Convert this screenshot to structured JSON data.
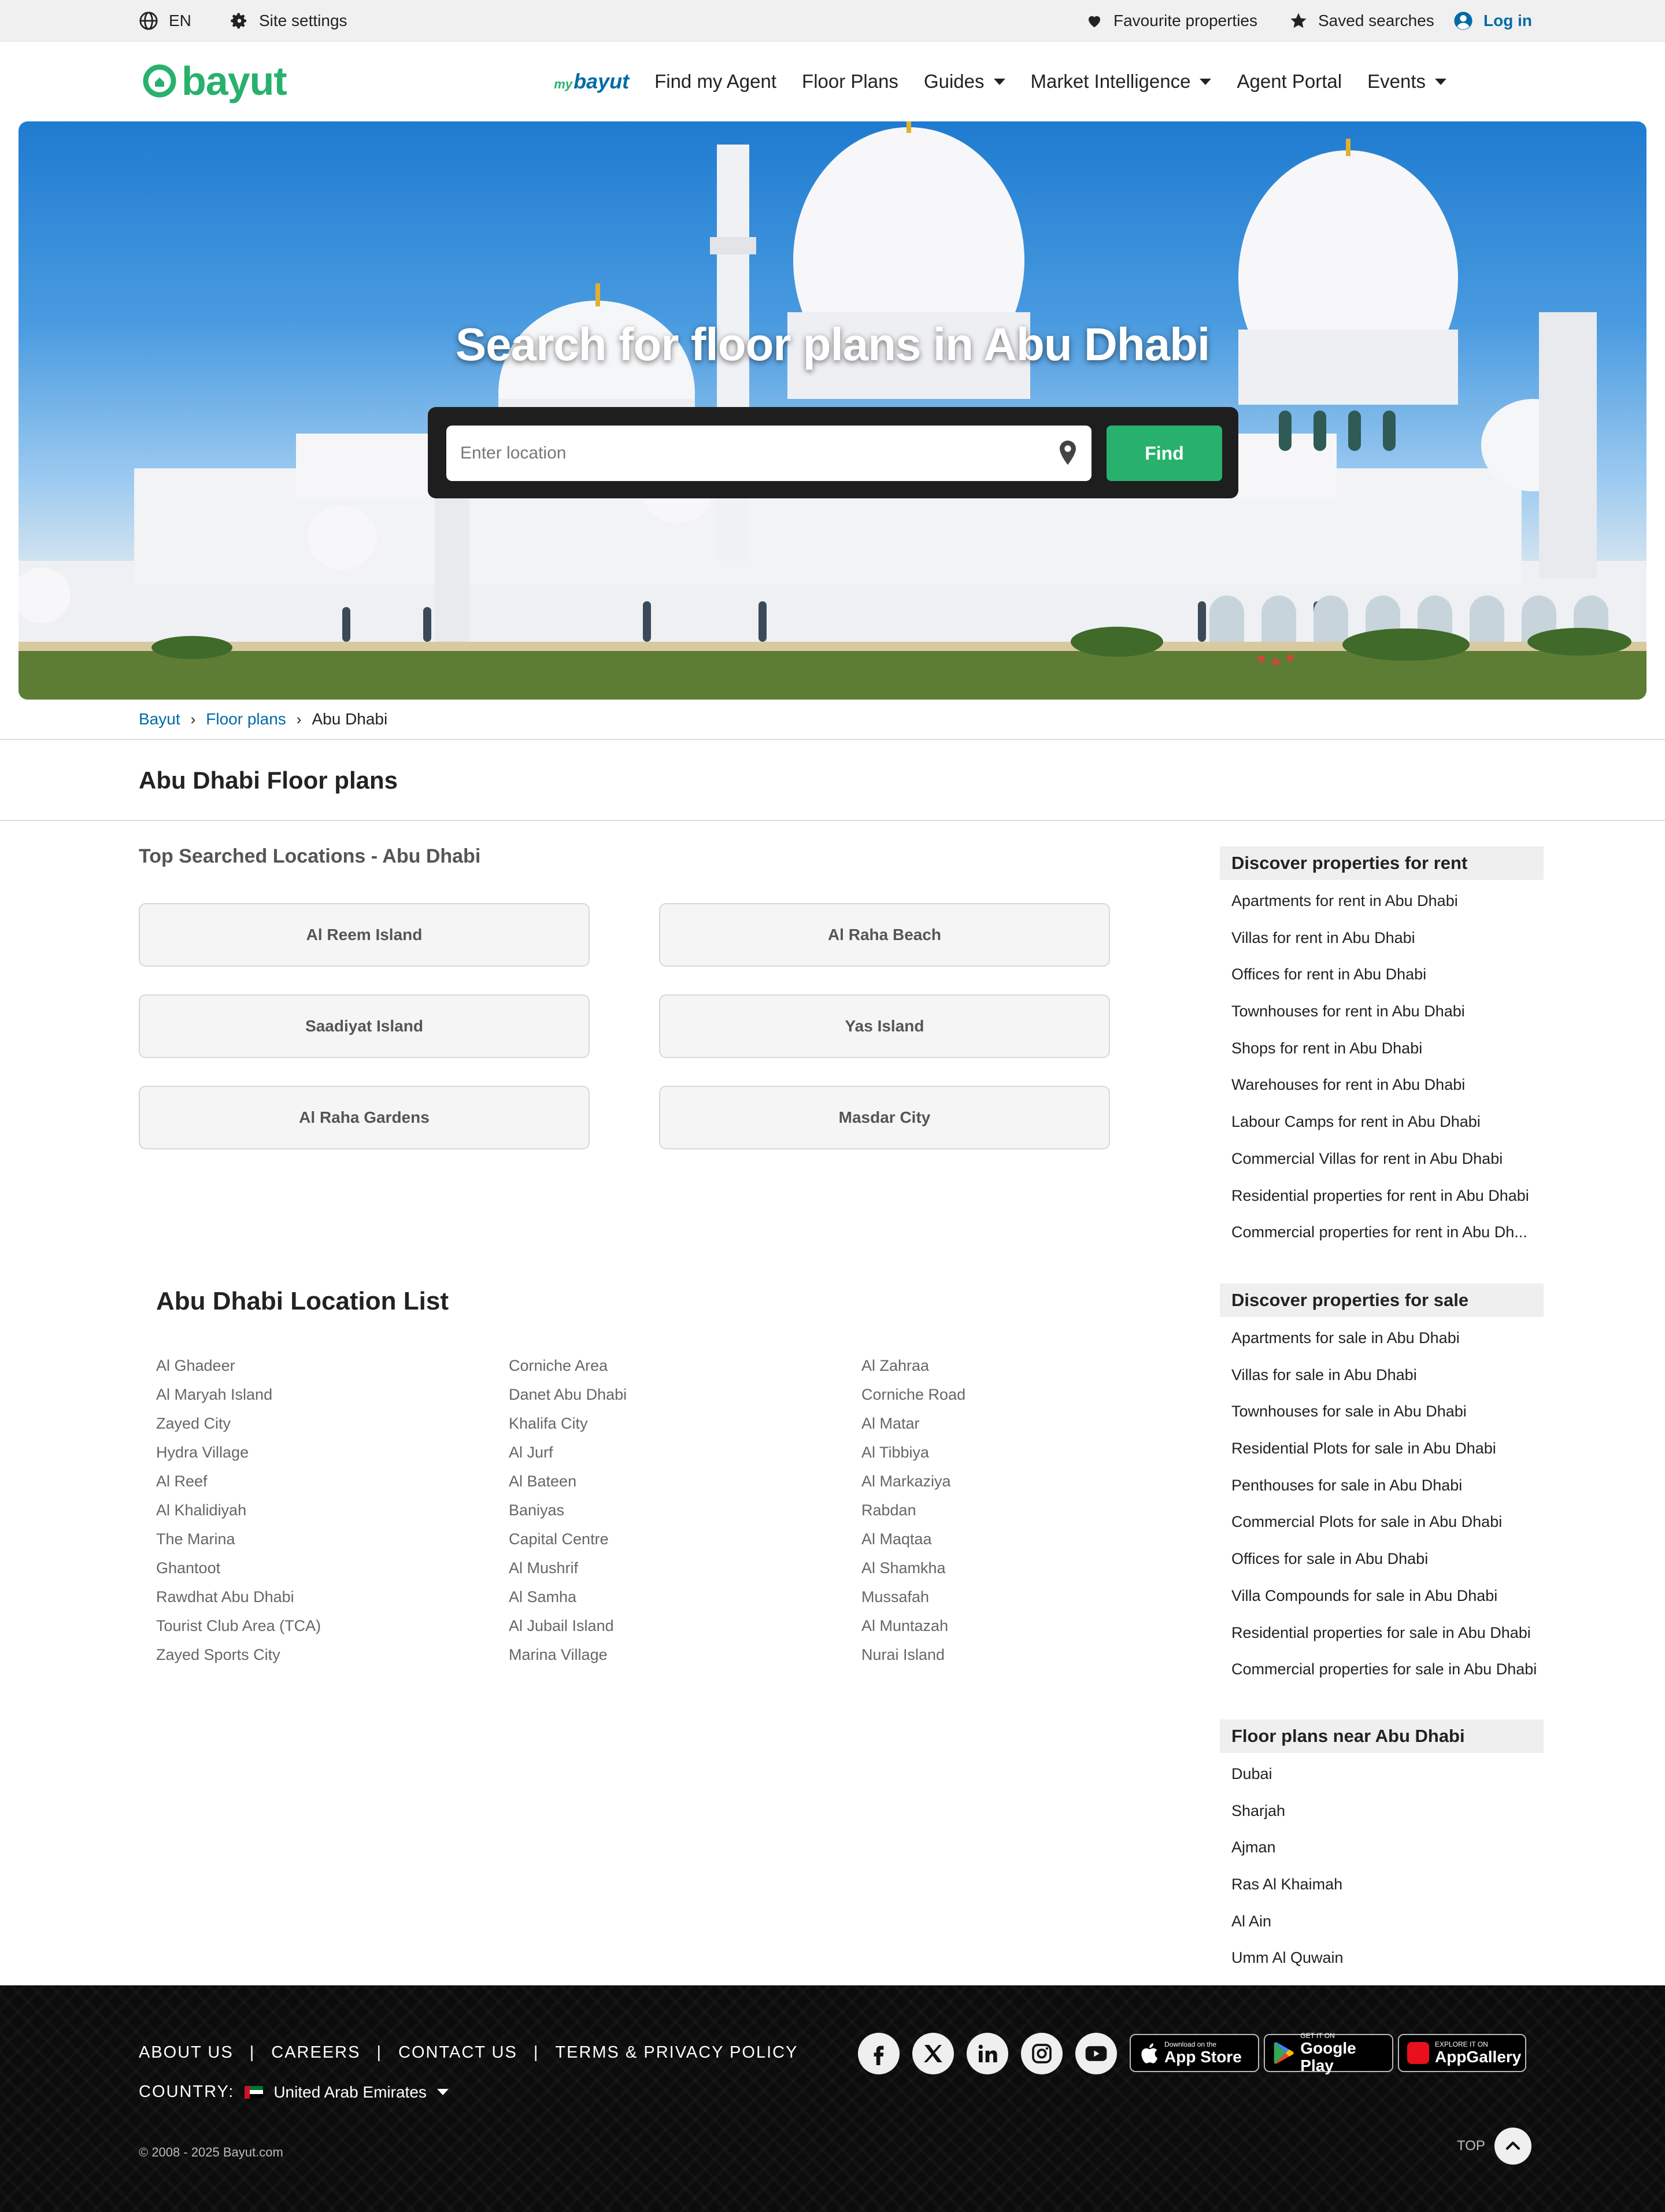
{
  "utility_bar": {
    "language": "EN",
    "site_settings": "Site settings",
    "favourite": "Favourite properties",
    "saved": "Saved searches",
    "login": "Log in"
  },
  "nav": {
    "logo": "bayut",
    "mybayut_prefix": "my",
    "mybayut_name": "bayut",
    "links": [
      "Find my Agent",
      "Floor Plans",
      "Guides",
      "Market Intelligence",
      "Agent Portal",
      "Events"
    ]
  },
  "hero": {
    "title": "Search for floor plans in Abu Dhabi",
    "search_placeholder": "Enter location",
    "find_button": "Find"
  },
  "breadcrumb": [
    "Bayut",
    "Floor plans",
    "Abu Dhabi"
  ],
  "page_title": "Abu Dhabi Floor plans",
  "top_searched": {
    "title": "Top Searched Locations - Abu Dhabi",
    "items": [
      "Al Reem Island",
      "Al Raha Beach",
      "Saadiyat Island",
      "Yas Island",
      "Al Raha Gardens",
      "Masdar City"
    ]
  },
  "location_list": {
    "title": "Abu Dhabi Location List",
    "columns": [
      [
        "Al Ghadeer",
        "Al Maryah Island",
        "Zayed City",
        "Hydra Village",
        "Al Reef",
        "Al Khalidiyah",
        "The Marina",
        "Ghantoot",
        "Rawdhat Abu Dhabi",
        "Tourist Club Area (TCA)",
        "Zayed Sports City"
      ],
      [
        "Corniche Area",
        "Danet Abu Dhabi",
        "Khalifa City",
        "Al Jurf",
        "Al Bateen",
        "Baniyas",
        "Capital Centre",
        "Al Mushrif",
        "Al Samha",
        "Al Jubail Island",
        "Marina Village"
      ],
      [
        "Al Zahraa",
        "Corniche Road",
        "Al Matar",
        "Al Tibbiya",
        "Al Markaziya",
        "Rabdan",
        "Al Maqtaa",
        "Al Shamkha",
        "Mussafah",
        "Al Muntazah",
        "Nurai Island"
      ]
    ]
  },
  "sidebar": {
    "rent": {
      "title": "Discover properties for rent",
      "items": [
        "Apartments for rent in Abu Dhabi",
        "Villas for rent in Abu Dhabi",
        "Offices for rent in Abu Dhabi",
        "Townhouses for rent in Abu Dhabi",
        "Shops for rent in Abu Dhabi",
        "Warehouses for rent in Abu Dhabi",
        "Labour Camps for rent in Abu Dhabi",
        "Commercial Villas for rent in Abu Dhabi",
        "Residential properties for rent in Abu Dhabi",
        "Commercial properties for rent in Abu Dh..."
      ]
    },
    "sale": {
      "title": "Discover properties for sale",
      "items": [
        "Apartments for sale in Abu Dhabi",
        "Villas for sale in Abu Dhabi",
        "Townhouses for sale in Abu Dhabi",
        "Residential Plots for sale in Abu Dhabi",
        "Penthouses for sale in Abu Dhabi",
        "Commercial Plots for sale in Abu Dhabi",
        "Offices for sale in Abu Dhabi",
        "Villa Compounds for sale in Abu Dhabi",
        "Residential properties for sale in Abu Dhabi",
        "Commercial properties for sale in Abu Dhabi"
      ]
    },
    "near": {
      "title": "Floor plans near Abu Dhabi",
      "items": [
        "Dubai",
        "Sharjah",
        "Ajman",
        "Ras Al Khaimah",
        "Al Ain",
        "Umm Al Quwain"
      ]
    }
  },
  "footer": {
    "links": [
      "ABOUT US",
      "CAREERS",
      "CONTACT US",
      "TERMS & PRIVACY POLICY"
    ],
    "separator": "|",
    "country_label": "COUNTRY:",
    "country": "United Arab Emirates",
    "copyright": "© 2008 - 2025 Bayut.com",
    "social_icons": [
      "facebook-icon",
      "x-icon",
      "linkedin-icon",
      "instagram-icon",
      "youtube-icon"
    ],
    "stores": [
      {
        "small": "Download on the",
        "big": "App Store"
      },
      {
        "small": "GET IT ON",
        "big": "Google Play"
      },
      {
        "small": "EXPLORE IT ON",
        "big": "AppGallery"
      }
    ],
    "top": "TOP"
  },
  "colors": {
    "brand_green": "#28b16d",
    "link_blue": "#006ba6",
    "footer_bg": "#0c0c0c"
  }
}
